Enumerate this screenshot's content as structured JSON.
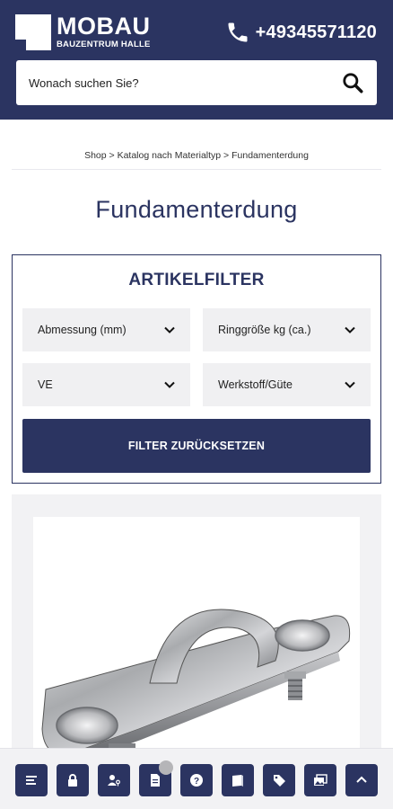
{
  "header": {
    "logo_word": "MOBAU",
    "logo_sub": "BAUZENTRUM HALLE",
    "phone": "+49345571120",
    "colors": {
      "brand": "#2b3461"
    }
  },
  "search": {
    "placeholder": "Wonach suchen Sie?"
  },
  "breadcrumb": {
    "text": "Shop > Katalog nach Materialtyp > Fundamenterdung"
  },
  "page": {
    "title": "Fundamenterdung"
  },
  "filter": {
    "title": "ARTIKELFILTER",
    "selects": [
      {
        "label": "Abmessung (mm)"
      },
      {
        "label": "Ringgröße kg (ca.)"
      },
      {
        "label": "VE"
      },
      {
        "label": "Werkstoff/Güte"
      }
    ],
    "reset_label": "FILTER ZURÜCKSETZEN"
  },
  "product": {
    "image": "galvanized-pipe-clamp-photo"
  },
  "bottom_bar": {
    "buttons": [
      {
        "icon": "menu-icon"
      },
      {
        "icon": "lock-icon"
      },
      {
        "icon": "user-key-icon"
      },
      {
        "icon": "document-icon"
      },
      {
        "icon": "help-icon"
      },
      {
        "icon": "catalog-icon"
      },
      {
        "icon": "tag-icon"
      },
      {
        "icon": "gallery-icon"
      },
      {
        "icon": "chevron-up-icon"
      }
    ]
  }
}
